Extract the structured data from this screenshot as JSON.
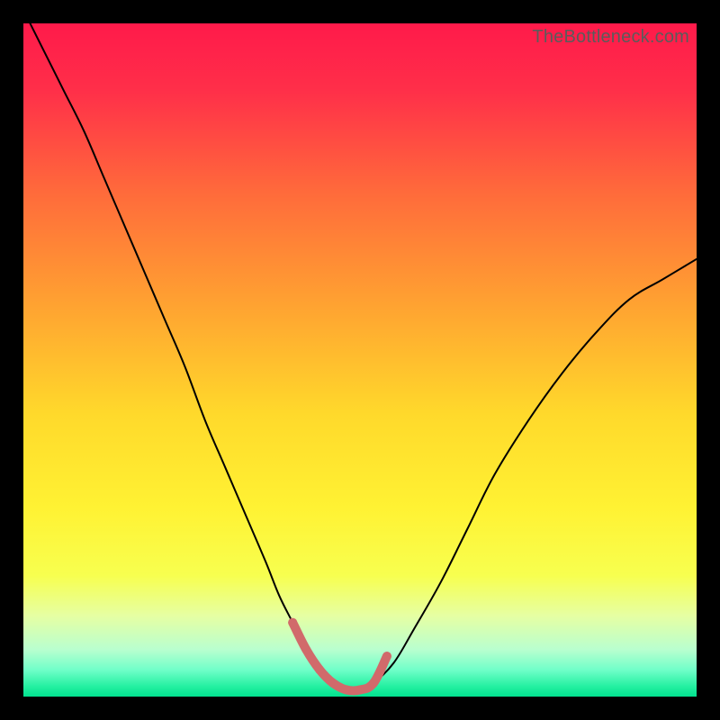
{
  "watermark": "TheBottleneck.com",
  "colors": {
    "frame": "#000000",
    "gradient_stops": [
      {
        "offset": 0.0,
        "color": "#ff1a4a"
      },
      {
        "offset": 0.1,
        "color": "#ff2f49"
      },
      {
        "offset": 0.25,
        "color": "#ff6a3b"
      },
      {
        "offset": 0.42,
        "color": "#ffa331"
      },
      {
        "offset": 0.58,
        "color": "#ffd92b"
      },
      {
        "offset": 0.72,
        "color": "#fff233"
      },
      {
        "offset": 0.82,
        "color": "#f7ff4f"
      },
      {
        "offset": 0.88,
        "color": "#e6ffa3"
      },
      {
        "offset": 0.93,
        "color": "#b9ffcf"
      },
      {
        "offset": 0.96,
        "color": "#71ffc9"
      },
      {
        "offset": 0.985,
        "color": "#24f0a1"
      },
      {
        "offset": 1.0,
        "color": "#01e28f"
      }
    ],
    "curve": "#000000",
    "highlight": "#d16a6b"
  },
  "chart_data": {
    "type": "line",
    "title": "",
    "xlabel": "",
    "ylabel": "",
    "xlim": [
      0,
      100
    ],
    "ylim": [
      0,
      100
    ],
    "grid": false,
    "series": [
      {
        "name": "bottleneck-curve",
        "x": [
          0,
          3,
          6,
          9,
          12,
          15,
          18,
          21,
          24,
          27,
          30,
          33,
          36,
          38,
          40,
          42,
          44,
          46,
          48,
          50,
          52,
          55,
          58,
          62,
          66,
          70,
          75,
          80,
          85,
          90,
          95,
          100
        ],
        "y": [
          102,
          96,
          90,
          84,
          77,
          70,
          63,
          56,
          49,
          41,
          34,
          27,
          20,
          15,
          11,
          7,
          4,
          2,
          1,
          1,
          2,
          5,
          10,
          17,
          25,
          33,
          41,
          48,
          54,
          59,
          62,
          65
        ]
      }
    ],
    "highlight_segment": {
      "name": "trough-highlight",
      "x": [
        40,
        42,
        44,
        46,
        48,
        50,
        52,
        54
      ],
      "y": [
        11,
        7,
        4,
        2,
        1,
        1,
        2,
        6
      ],
      "node_radius_px": 5,
      "stroke_width_px": 10
    },
    "annotations": [
      {
        "text": "TheBottleneck.com",
        "position": "top-right"
      }
    ]
  }
}
